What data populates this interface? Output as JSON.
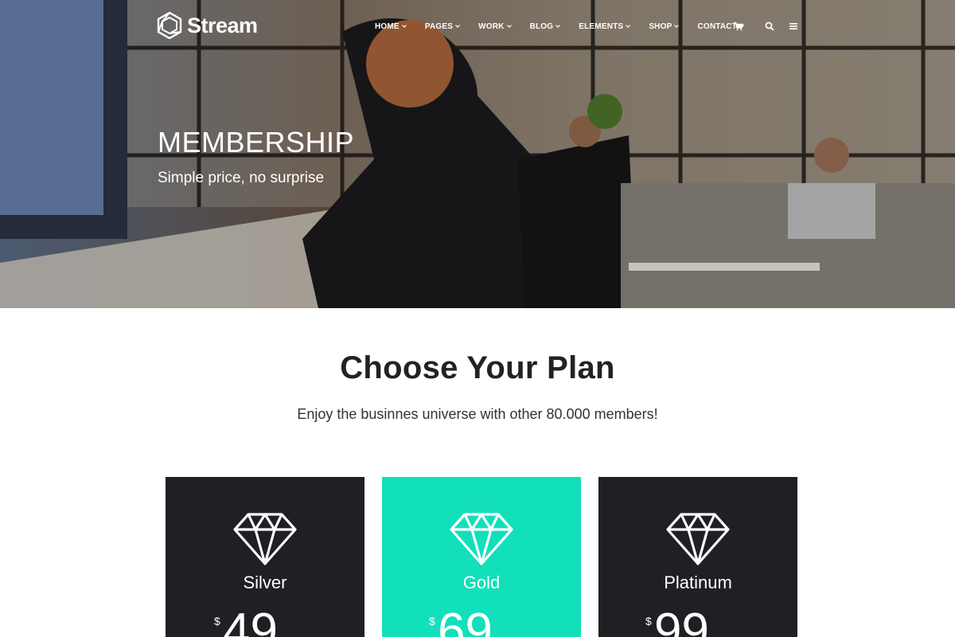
{
  "brand": {
    "name": "Stream"
  },
  "nav": {
    "items": [
      {
        "label": "HOME"
      },
      {
        "label": "PAGES"
      },
      {
        "label": "WORK"
      },
      {
        "label": "BLOG"
      },
      {
        "label": "ELEMENTS"
      },
      {
        "label": "SHOP"
      },
      {
        "label": "CONTACT"
      }
    ],
    "icons": [
      "cart-icon",
      "search-icon",
      "menu-icon"
    ]
  },
  "hero": {
    "title": "MEMBERSHIP",
    "subtitle": "Simple price, no surprise"
  },
  "section": {
    "title": "Choose Your Plan",
    "subtitle": "Enjoy the businnes universe with other 80.000 members!"
  },
  "plans": [
    {
      "name": "Silver",
      "currency": "$",
      "price": "49",
      "background": "#1f1f24"
    },
    {
      "name": "Gold",
      "currency": "$",
      "price": "69",
      "background": "#12e0bb"
    },
    {
      "name": "Platinum",
      "currency": "$",
      "price": "99",
      "background": "#1f1f24"
    }
  ],
  "colors": {
    "accent": "#12e0bb",
    "dark": "#1f1f24"
  }
}
